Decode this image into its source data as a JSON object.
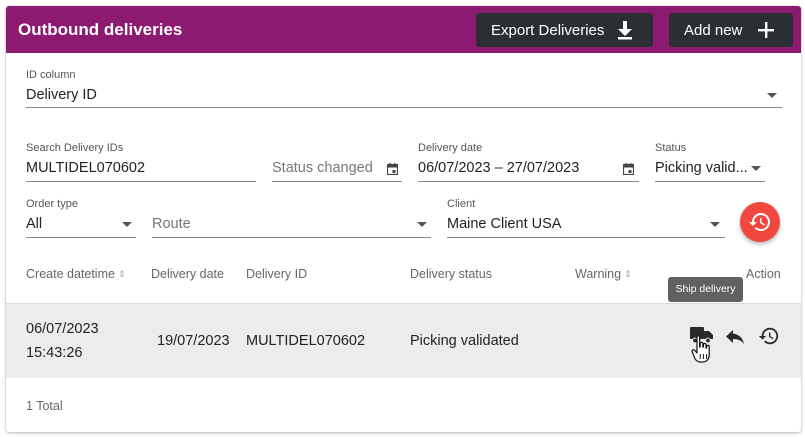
{
  "header": {
    "title": "Outbound deliveries",
    "export_label": "Export Deliveries",
    "add_label": "Add new"
  },
  "filters": {
    "id_column": {
      "label": "ID column",
      "value": "Delivery ID"
    },
    "search_ids": {
      "label": "Search Delivery IDs",
      "value": "MULTIDEL070602"
    },
    "status_changed": {
      "placeholder": "Status changed"
    },
    "delivery_date": {
      "label": "Delivery date",
      "value": "06/07/2023 – 27/07/2023"
    },
    "status": {
      "label": "Status",
      "value": "Picking valid..."
    },
    "order_type": {
      "label": "Order type",
      "value": "All"
    },
    "route": {
      "placeholder": "Route"
    },
    "client": {
      "label": "Client",
      "value": "Maine Client USA"
    }
  },
  "table": {
    "columns": {
      "create_datetime": "Create datetime",
      "delivery_date": "Delivery date",
      "delivery_id": "Delivery ID",
      "delivery_status": "Delivery status",
      "warning": "Warning",
      "action": "Action"
    },
    "rows": [
      {
        "create_date": "06/07/2023",
        "create_time": "15:43:26",
        "delivery_date": "19/07/2023",
        "delivery_id": "MULTIDEL070602",
        "delivery_status": "Picking validated"
      }
    ],
    "tooltip": "Ship delivery",
    "total": "1 Total"
  },
  "icons": {
    "export": "download-icon",
    "add": "plus-icon",
    "calendar": "calendar-icon",
    "reset": "history-icon",
    "ship": "truck-icon",
    "return": "reply-icon",
    "history": "history-icon"
  },
  "colors": {
    "header_bg": "#8c1a71",
    "button_bg": "#2b2f33",
    "fab_bg": "#f0483e",
    "row_bg": "#ececec",
    "tooltip_bg": "#616161"
  }
}
